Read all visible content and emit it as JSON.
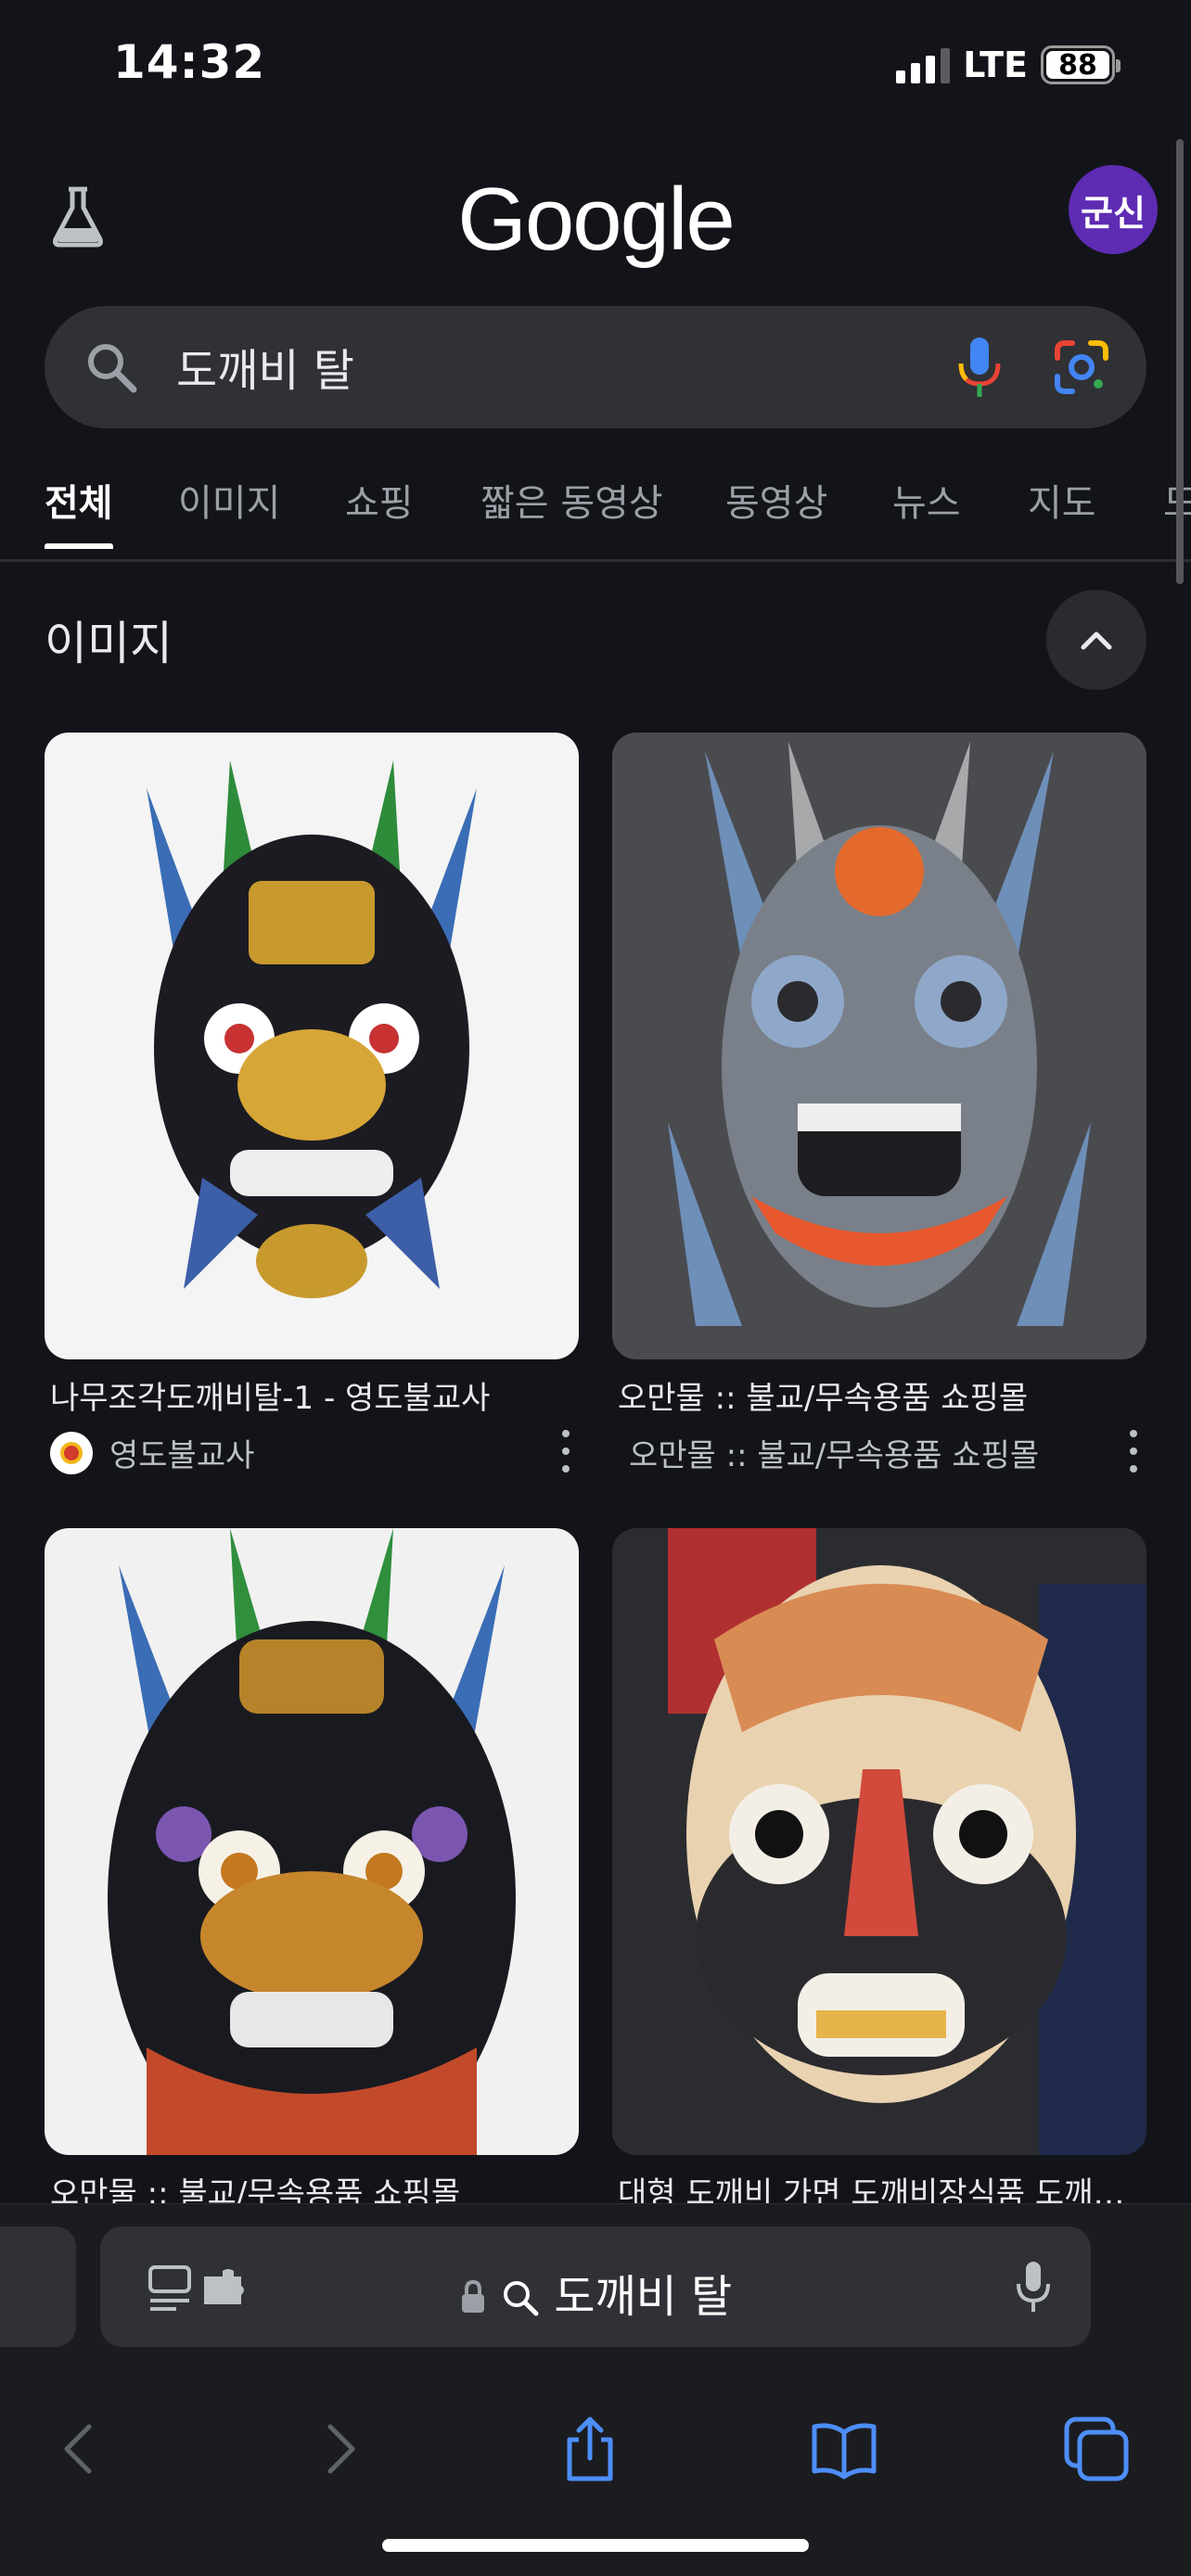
{
  "status_bar": {
    "time": "14:32",
    "network": "LTE",
    "battery": "88"
  },
  "header": {
    "logo": "Google",
    "avatar_initials": "군신"
  },
  "search": {
    "query": "도깨비 탈"
  },
  "tabs": [
    "전체",
    "이미지",
    "쇼핑",
    "짧은 동영상",
    "동영상",
    "뉴스",
    "지도",
    "도"
  ],
  "active_tab": "전체",
  "section": {
    "title": "이미지"
  },
  "results": [
    {
      "title": "나무조각도깨비탈-1 - 영도불교사",
      "source": "영도불교사",
      "has_favicon": true
    },
    {
      "title": "오만물 :: 불교/무속용품 쇼핑몰",
      "source": "오만물 :: 불교/무속용품 쇼핑몰",
      "has_favicon": false
    },
    {
      "title": "오만물 :: 불교/무속용품 쇼핑몰",
      "source": "",
      "has_favicon": false
    },
    {
      "title": "대형 도깨비 가면 도깨비장식품 도깨비...",
      "source": "",
      "has_favicon": false
    }
  ],
  "browser": {
    "address": "도깨비 탈"
  },
  "colors": {
    "background": "#131419",
    "avatar": "#5e2bb3",
    "accent_blue": "#4d8ef7"
  }
}
